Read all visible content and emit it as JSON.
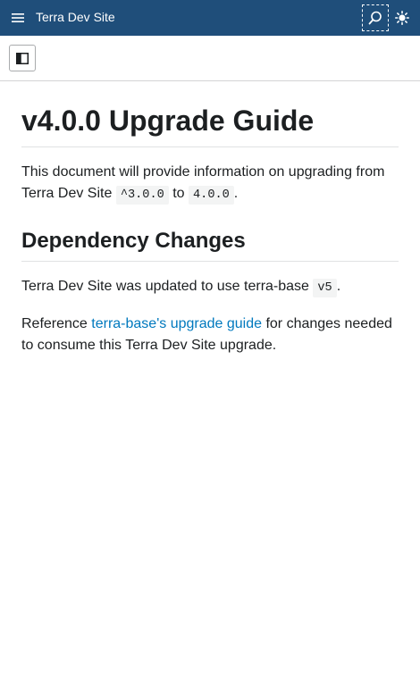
{
  "header": {
    "menu_icon": "hamburger-menu-icon",
    "title": "Terra Dev Site",
    "search_icon": "search-icon",
    "theme_icon": "sun-icon"
  },
  "toolbar": {
    "panel_toggle_icon": "sidebar-panel-toggle-icon"
  },
  "main": {
    "title": "v4.0.0 Upgrade Guide",
    "intro": {
      "text_before": "This document will provide information on upgrading from Terra Dev Site ",
      "from_version": "^3.0.0",
      "text_middle": " to ",
      "to_version": "4.0.0",
      "text_after": "."
    },
    "section": {
      "heading": "Dependency Changes",
      "paragraph1": {
        "text_before": "Terra Dev Site was updated to use terra-base ",
        "version": "v5",
        "text_after": "."
      },
      "paragraph2": {
        "text_before": "Reference ",
        "link_text": "terra-base's upgrade guide",
        "text_after": " for changes needed to consume this Terra Dev Site upgrade."
      }
    }
  },
  "colors": {
    "header_bg": "#1f4e7a",
    "link": "#0079be",
    "text": "#1c1f21",
    "code_bg": "#f3f4f4"
  }
}
